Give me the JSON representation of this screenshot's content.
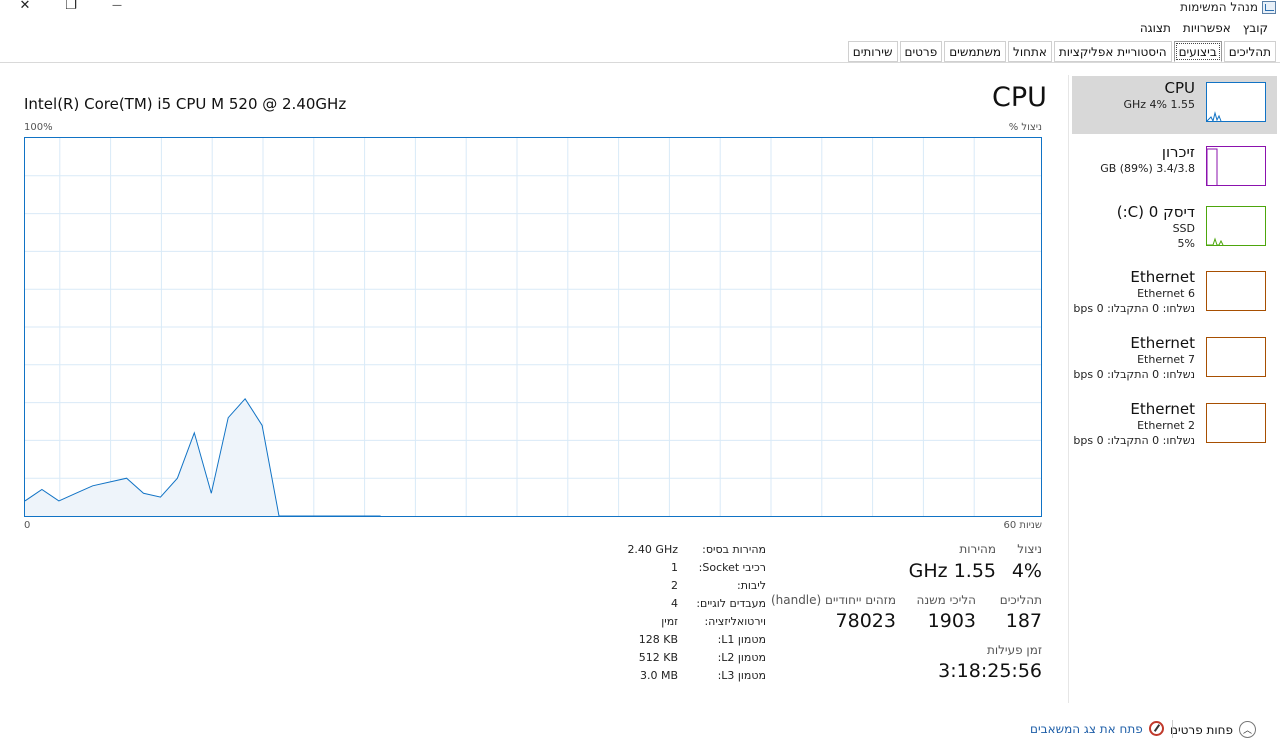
{
  "window": {
    "title": "מנהל המשימות",
    "close": "✕",
    "restore": "❐",
    "minimize": "—"
  },
  "menu": [
    "קובץ",
    "אפשרויות",
    "תצוגה"
  ],
  "tabs": [
    {
      "label": "תהליכים",
      "active": false
    },
    {
      "label": "ביצועים",
      "active": true
    },
    {
      "label": "היסטוריית אפליקציות",
      "active": false
    },
    {
      "label": "אתחול",
      "active": false
    },
    {
      "label": "משתמשים",
      "active": false
    },
    {
      "label": "פרטים",
      "active": false
    },
    {
      "label": "שירותים",
      "active": false
    }
  ],
  "main": {
    "title": "CPU",
    "model": "Intel(R) Core(TM) i5 CPU M 520 @ 2.40GHz",
    "y_max_label": "100%",
    "util_label": "% ניצול",
    "x_min_label": "0",
    "x_max_label": "60 שניות"
  },
  "chart_data": {
    "type": "area",
    "ylim": [
      0,
      100
    ],
    "xlim": [
      60,
      0
    ],
    "x": [
      60,
      59,
      58,
      57,
      56,
      55,
      54,
      53,
      52,
      51,
      50,
      49,
      48,
      47,
      46,
      45,
      44,
      43,
      42,
      41,
      40,
      39
    ],
    "values": [
      4,
      7,
      4,
      6,
      8,
      9,
      10,
      6,
      5,
      10,
      22,
      6,
      26,
      31,
      24,
      0,
      0,
      0,
      0,
      0,
      0,
      0
    ],
    "color": "#1173c5",
    "fill": "#eef4fa",
    "grid": true
  },
  "stats": {
    "util": {
      "label": "ניצול",
      "value": "4%"
    },
    "speed": {
      "label": "מהירות",
      "value": "1.55 GHz"
    },
    "processes": {
      "label": "תהליכים",
      "value": "187"
    },
    "threads": {
      "label": "הליכי משנה",
      "value": "1903"
    },
    "handles": {
      "label": "מזהים ייחודיים (handle)",
      "value": "78023"
    },
    "uptime": {
      "label": "זמן פעילות",
      "value": "3:18:25:56"
    }
  },
  "specs": [
    {
      "label": "מהירות בסיס:",
      "value": "2.40 GHz"
    },
    {
      "label": "רכיבי Socket:",
      "value": "1"
    },
    {
      "label": "ליבות:",
      "value": "2"
    },
    {
      "label": "מעבדים לוגיים:",
      "value": "4"
    },
    {
      "label": "וירטואליזציה:",
      "value": "זמין"
    },
    {
      "label": "מטמון L1:",
      "value": "128 KB"
    },
    {
      "label": "מטמון L2:",
      "value": "512 KB"
    },
    {
      "label": "מטמון L3:",
      "value": "3.0 MB"
    }
  ],
  "sidebar": [
    {
      "name": "CPU",
      "sub1": "1.55 GHz  4%",
      "sub2": "",
      "color": "#1173c5",
      "selected": true
    },
    {
      "name": "זיכרון",
      "sub1": "3.4/3.8 GB (89%)",
      "sub2": "",
      "color": "#8b12ae",
      "selected": false
    },
    {
      "name": "דיסק 0 (C:)",
      "sub1": "SSD",
      "sub2": "5%",
      "color": "#4da60c",
      "selected": false
    },
    {
      "name": "Ethernet",
      "sub1": "Ethernet 6",
      "sub2": "נשלחו: 0 התקבלו: 0 bps",
      "color": "#a74f01",
      "selected": false
    },
    {
      "name": "Ethernet",
      "sub1": "Ethernet 7",
      "sub2": "נשלחו: 0 התקבלו: 0 bps",
      "color": "#a74f01",
      "selected": false
    },
    {
      "name": "Ethernet",
      "sub1": "Ethernet 2",
      "sub2": "נשלחו: 0 התקבלו: 0 bps",
      "color": "#a74f01",
      "selected": false
    }
  ],
  "footer": {
    "fewer_details": "פחות פרטים",
    "resource_monitor": "פתח את צג המשאבים"
  }
}
